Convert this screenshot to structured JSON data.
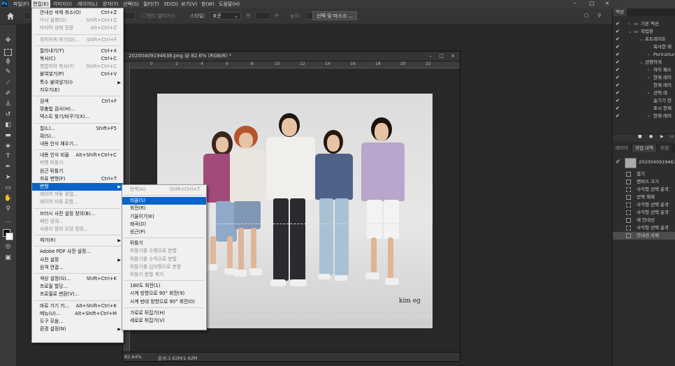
{
  "menubar": {
    "items": [
      "파일(F)",
      "편집(E)",
      "이미지(I)",
      "레이어(L)",
      "문자(Y)",
      "선택(S)",
      "필터(T)",
      "3D(D)",
      "보기(V)",
      "창(W)",
      "도움말(H)"
    ],
    "active_index": 1,
    "app_icon": "Ps"
  },
  "options_bar": {
    "anti_alias": "앤티 앨리어스",
    "style_label": "스타일:",
    "style_value": "표준",
    "width_label": "폭:",
    "height_label": "높이:",
    "select_mask_button": "선택 및 마스크 ..."
  },
  "document": {
    "title": "20200409194638.png @ 82.6% (RGB/8) *",
    "ruler_ticks": [
      "0",
      "2",
      "4",
      "6",
      "8",
      "10",
      "12",
      "14",
      "16",
      "18",
      "20",
      "22"
    ],
    "zoom": "82.64%",
    "doc_info": "문서:1.62M/1.62M",
    "watermark": "kim eg"
  },
  "edit_menu": {
    "items": [
      {
        "label": "안내선 삭제 취소(O)",
        "shortcut": "Ctrl+Z",
        "disabled": false
      },
      {
        "label": "다시 실행(O)",
        "shortcut": "Shift+Ctrl+Z",
        "disabled": true
      },
      {
        "label": "마지막 상태 전환",
        "shortcut": "Alt+Ctrl+Z",
        "disabled": true
      },
      {
        "sep": true
      },
      {
        "label": "희미하게 하기(D)...",
        "shortcut": "Shift+Ctrl+F",
        "disabled": true
      },
      {
        "sep": true
      },
      {
        "label": "잘라내기(T)",
        "shortcut": "Ctrl+X",
        "disabled": false
      },
      {
        "label": "복사(C)",
        "shortcut": "Ctrl+C",
        "disabled": false
      },
      {
        "label": "병합하여 복사(Y)",
        "shortcut": "Shift+Ctrl+C",
        "disabled": true
      },
      {
        "label": "붙여넣기(P)",
        "shortcut": "Ctrl+V",
        "disabled": false
      },
      {
        "label": "특수 붙여넣기(I)",
        "shortcut": "",
        "disabled": false,
        "submenu": true
      },
      {
        "label": "지우기(E)",
        "shortcut": "",
        "disabled": false
      },
      {
        "sep": true
      },
      {
        "label": "검색",
        "shortcut": "Ctrl+F",
        "disabled": false
      },
      {
        "label": "맞춤법 검사(H)...",
        "shortcut": "",
        "disabled": false
      },
      {
        "label": "텍스트 찾기/바꾸기(X)...",
        "shortcut": "",
        "disabled": false
      },
      {
        "sep": true
      },
      {
        "label": "칠(L)...",
        "shortcut": "Shift+F5",
        "disabled": false
      },
      {
        "label": "획(S)...",
        "shortcut": "",
        "disabled": false
      },
      {
        "label": "내용 인식 채우기...",
        "shortcut": "",
        "disabled": false
      },
      {
        "sep": true
      },
      {
        "label": "내용 인식 비율",
        "shortcut": "Alt+Shift+Ctrl+C",
        "disabled": false
      },
      {
        "label": "퍼펫 뒤틀기",
        "shortcut": "",
        "disabled": true
      },
      {
        "label": "원근 뒤틀기",
        "shortcut": "",
        "disabled": false
      },
      {
        "label": "자유 변형(F)",
        "shortcut": "Ctrl+T",
        "disabled": false
      },
      {
        "label": "변형",
        "shortcut": "",
        "disabled": false,
        "submenu": true,
        "highlighted": true
      },
      {
        "label": "레이어 자동 정렬...",
        "shortcut": "",
        "disabled": true
      },
      {
        "label": "레이어 자동 혼합...",
        "shortcut": "",
        "disabled": true
      },
      {
        "sep": true
      },
      {
        "label": "브러시 사전 설정 정의(B)...",
        "shortcut": "",
        "disabled": false
      },
      {
        "label": "패턴 정의...",
        "shortcut": "",
        "disabled": true
      },
      {
        "label": "사용자 정의 모양 정의...",
        "shortcut": "",
        "disabled": true
      },
      {
        "sep": true
      },
      {
        "label": "제거(R)",
        "shortcut": "",
        "disabled": false,
        "submenu": true
      },
      {
        "sep": true
      },
      {
        "label": "Adobe PDF 사전 설정...",
        "shortcut": "",
        "disabled": false
      },
      {
        "label": "사전 설정",
        "shortcut": "",
        "disabled": false,
        "submenu": true
      },
      {
        "label": "원격 연결...",
        "shortcut": "",
        "disabled": false
      },
      {
        "sep": true
      },
      {
        "label": "색상 설정(G)...",
        "shortcut": "Shift+Ctrl+K",
        "disabled": false
      },
      {
        "label": "프로필 할당...",
        "shortcut": "",
        "disabled": false
      },
      {
        "label": "프로필로 변환(V)...",
        "shortcut": "",
        "disabled": false
      },
      {
        "sep": true
      },
      {
        "label": "바로 가기 키...",
        "shortcut": "Alt+Shift+Ctrl+K",
        "disabled": false
      },
      {
        "label": "메뉴(U)...",
        "shortcut": "Alt+Shift+Ctrl+M",
        "disabled": false
      },
      {
        "label": "도구 모음...",
        "shortcut": "",
        "disabled": false
      },
      {
        "label": "환경 설정(N)",
        "shortcut": "",
        "disabled": false,
        "submenu": true
      }
    ]
  },
  "transform_menu": {
    "items": [
      {
        "label": "반복(A)",
        "shortcut": "Shift+Ctrl+T",
        "disabled": true
      },
      {
        "sep": true
      },
      {
        "label": "비율(S)",
        "shortcut": "",
        "disabled": false,
        "highlighted": true
      },
      {
        "label": "회전(R)",
        "shortcut": "",
        "disabled": false
      },
      {
        "label": "기울이기(K)",
        "shortcut": "",
        "disabled": false
      },
      {
        "label": "왜곡(D)",
        "shortcut": "",
        "disabled": false
      },
      {
        "label": "원근(P)",
        "shortcut": "",
        "disabled": false
      },
      {
        "sep": true
      },
      {
        "label": "뒤틀기",
        "shortcut": "",
        "disabled": false
      },
      {
        "label": "뒤틀기를 수평으로 분할",
        "shortcut": "",
        "disabled": true
      },
      {
        "label": "뒤틀기를 수직으로 분할",
        "shortcut": "",
        "disabled": true
      },
      {
        "label": "뒤틀기를 십자형으로 분할",
        "shortcut": "",
        "disabled": true
      },
      {
        "label": "뒤틀기 분할 제거",
        "shortcut": "",
        "disabled": true
      },
      {
        "sep": true
      },
      {
        "label": "180도 회전(1)",
        "shortcut": "",
        "disabled": false
      },
      {
        "label": "시계 방향으로 90° 회전(9)",
        "shortcut": "",
        "disabled": false
      },
      {
        "label": "시계 반대 방향으로 90° 회전(0)",
        "shortcut": "",
        "disabled": false
      },
      {
        "sep": true
      },
      {
        "label": "가로로 뒤집기(H)",
        "shortcut": "",
        "disabled": false
      },
      {
        "label": "세로로 뒤집기(V)",
        "shortcut": "",
        "disabled": false
      }
    ]
  },
  "actions_panel": {
    "tab": "액션",
    "rows": [
      "기본 액션",
      "작업용",
      "포트레이트",
      "복사한 레",
      "Portraiture",
      "선명하게",
      "하이 패스",
      "현재 레이",
      "현재 레이",
      "선택 레",
      "숨기기 현",
      "표시 현재",
      "현재 레이"
    ]
  },
  "history_panel": {
    "tabs": [
      "레이어",
      "작업 내역",
      "조정"
    ],
    "snapshot": "20200409194638.p",
    "rows": [
      "열기",
      "캔버스 크기",
      "사각형 선택 윤곽",
      "선택 해제",
      "사각형 선택 윤곽",
      "사각형 선택 윤곽",
      "새 안내선",
      "사각형 선택 윤곽",
      "안내선 삭제"
    ]
  }
}
